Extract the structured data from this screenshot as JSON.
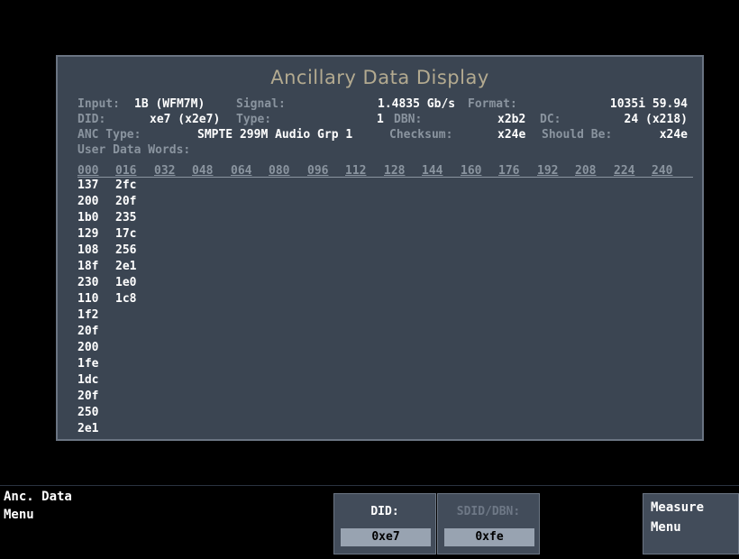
{
  "title": "Ancillary Data Display",
  "fields": {
    "input_label": "Input:",
    "input_value": "1B (WFM7M)",
    "signal_label": "Signal:",
    "signal_value": "1.4835 Gb/s",
    "format_label": "Format:",
    "format_value": "1035i 59.94",
    "did_label": "DID:",
    "did_value": "xe7 (x2e7)",
    "type_label": "Type:",
    "type_value": "1",
    "dbn_label": "DBN:",
    "dbn_value": "x2b2",
    "dc_label": "DC:",
    "dc_value": "24 (x218)",
    "anc_type_label": "ANC Type:",
    "anc_type_value": "SMPTE 299M Audio Grp 1",
    "checksum_label": "Checksum:",
    "checksum_value": "x24e",
    "should_be_label": "Should Be:",
    "should_be_value": "x24e",
    "user_data_label": "User Data Words:"
  },
  "column_headers": [
    "000",
    "016",
    "032",
    "048",
    "064",
    "080",
    "096",
    "112",
    "128",
    "144",
    "160",
    "176",
    "192",
    "208",
    "224",
    "240"
  ],
  "data_columns": [
    [
      "137",
      "200",
      "1b0",
      "129",
      "108",
      "18f",
      "230",
      "110",
      "1f2",
      "20f",
      "200",
      "1fe",
      "1dc",
      "20f",
      "250",
      "2e1"
    ],
    [
      "2fc",
      "20f",
      "235",
      "17c",
      "256",
      "2e1",
      "1e0",
      "1c8"
    ]
  ],
  "bottom": {
    "left_menu_line1": "Anc. Data",
    "left_menu_line2": "Menu",
    "did_key_label": "DID:",
    "did_key_value": "0xe7",
    "sdid_key_label": "SDID/DBN:",
    "sdid_key_value": "0xfe",
    "measure_line1": "Measure",
    "measure_line2": "Menu"
  }
}
